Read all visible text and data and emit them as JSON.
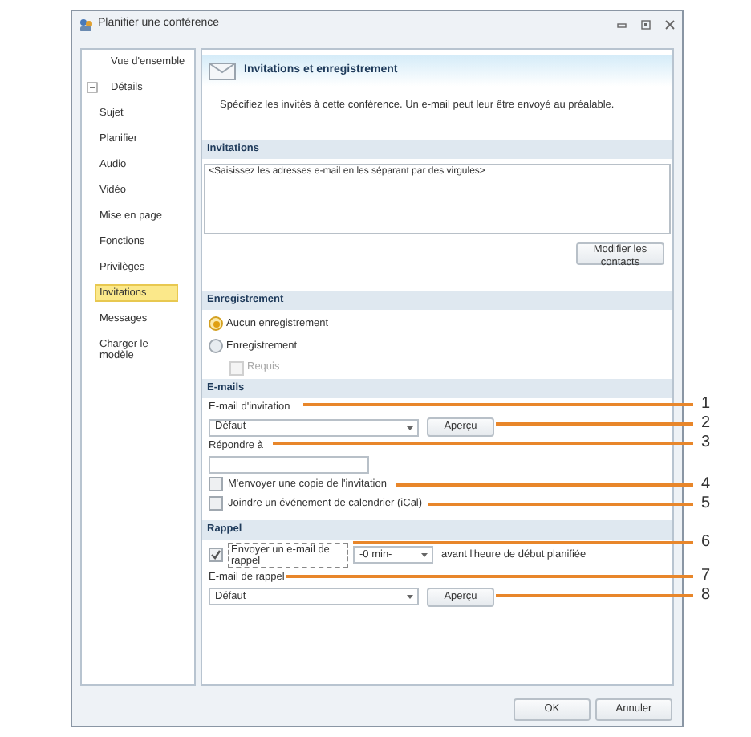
{
  "window": {
    "title": "Planifier une conférence"
  },
  "sidebar": {
    "items": [
      {
        "label": "Vue d'ensemble",
        "selected": false
      },
      {
        "label": "Détails",
        "selected": false,
        "expanded": true,
        "children": [
          {
            "label": "Sujet",
            "selected": false
          },
          {
            "label": "Planifier",
            "selected": false
          },
          {
            "label": "Audio",
            "selected": false
          },
          {
            "label": "Vidéo",
            "selected": false
          },
          {
            "label": "Mise en page",
            "selected": false
          },
          {
            "label": "Fonctions",
            "selected": false
          },
          {
            "label": "Privilèges",
            "selected": false
          },
          {
            "label": "Invitations",
            "selected": true
          },
          {
            "label": "Messages",
            "selected": false
          },
          {
            "label": "Charger le modèle",
            "selected": false
          }
        ]
      }
    ]
  },
  "header": {
    "title": "Invitations et enregistrement",
    "description": "Spécifiez les invités à cette conférence.  Un e-mail peut leur être envoyé au préalable."
  },
  "invitations": {
    "heading": "Invitations",
    "placeholder": "<Saisissez les adresses e-mail en les séparant par des virgules>",
    "button": "Modifier les contacts"
  },
  "recording": {
    "heading": "Enregistrement",
    "options": [
      {
        "label": "Aucun enregistrement",
        "selected": true
      },
      {
        "label": "Enregistrement",
        "selected": false
      }
    ],
    "required": {
      "label": "Requis",
      "checked": false,
      "disabled": true
    }
  },
  "emails": {
    "heading": "E-mails",
    "invitation_label": "E-mail d'invitation",
    "invitation_value": "Défaut",
    "preview": "Aperçu",
    "reply_label": "Répondre à",
    "checkboxes": [
      {
        "label": "M'envoyer une copie de l'invitation",
        "checked": false
      },
      {
        "label": "Joindre un événement de calendrier (iCal)",
        "checked": false
      }
    ]
  },
  "reminder": {
    "heading": "Rappel",
    "send": {
      "label": "Envoyer un e-mail de rappel",
      "checked": true
    },
    "offset": "-0 min-",
    "offset_suffix": "avant l'heure de début planifiée",
    "email_label": "E-mail de rappel",
    "email_value": "Défaut",
    "preview": "Aperçu"
  },
  "footer": {
    "buttons": [
      "OK",
      "Annuler"
    ]
  },
  "callouts": [
    "1",
    "2",
    "3",
    "4",
    "5",
    "6",
    "7",
    "8"
  ]
}
